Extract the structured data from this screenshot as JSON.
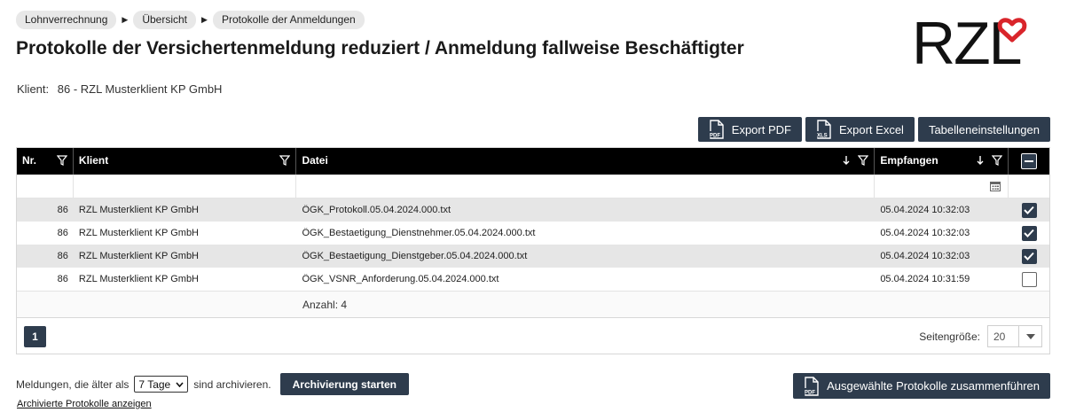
{
  "breadcrumb": [
    "Lohnverrechnung",
    "Übersicht",
    "Protokolle der Anmeldungen"
  ],
  "title": "Protokolle der Versichertenmeldung reduziert / Anmeldung fallweise Beschäftigter",
  "logo": {
    "text": "RZL",
    "color": "#d9252b"
  },
  "client": {
    "label": "Klient:",
    "value": "86 - RZL Musterklient KP GmbH"
  },
  "toolbar": {
    "export_pdf": "Export PDF",
    "export_excel": "Export Excel",
    "table_settings": "Tabelleneinstellungen",
    "pdf_icon_text": "PDF",
    "xls_icon_text": "XLS"
  },
  "columns": {
    "nr": "Nr.",
    "klient": "Klient",
    "datei": "Datei",
    "empfangen": "Empfangen"
  },
  "rows": [
    {
      "nr": "86",
      "klient": "RZL Musterklient KP GmbH",
      "datei": "ÖGK_Protokoll.05.04.2024.000.txt",
      "empfangen": "05.04.2024 10:32:03",
      "checked": true
    },
    {
      "nr": "86",
      "klient": "RZL Musterklient KP GmbH",
      "datei": "ÖGK_Bestaetigung_Dienstnehmer.05.04.2024.000.txt",
      "empfangen": "05.04.2024 10:32:03",
      "checked": true
    },
    {
      "nr": "86",
      "klient": "RZL Musterklient KP GmbH",
      "datei": "ÖGK_Bestaetigung_Dienstgeber.05.04.2024.000.txt",
      "empfangen": "05.04.2024 10:32:03",
      "checked": true
    },
    {
      "nr": "86",
      "klient": "RZL Musterklient KP GmbH",
      "datei": "ÖGK_VSNR_Anforderung.05.04.2024.000.txt",
      "empfangen": "05.04.2024 10:31:59",
      "checked": false
    }
  ],
  "summary": {
    "count": "Anzahl: 4"
  },
  "pager": {
    "current_page": "1",
    "page_size_label": "Seitengröße:",
    "page_size": "20"
  },
  "archive": {
    "prefix": "Meldungen, die älter als",
    "selected": "7 Tage",
    "suffix": "sind archivieren.",
    "start_button": "Archivierung starten",
    "link": "Archivierte Protokolle anzeigen"
  },
  "merge_button": "Ausgewählte Protokolle zusammenführen",
  "colors": {
    "button": "#2e3c4d",
    "header": "#000000",
    "logo_heart": "#d9252b"
  }
}
